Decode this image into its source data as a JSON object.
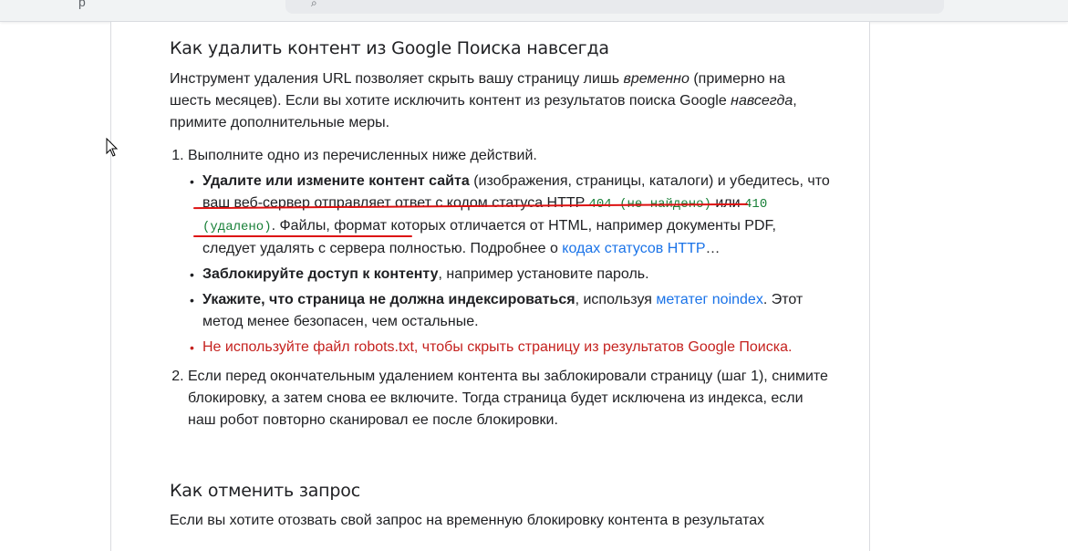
{
  "topbar": {
    "left_text": "р"
  },
  "sections": {
    "remove": {
      "title": "Как удалить контент из Google Поиска навсегда",
      "intro_1": "Инструмент удаления URL позволяет скрыть вашу страницу лишь ",
      "intro_em1": "временно",
      "intro_2": " (примерно на шесть месяцев). Если вы хотите исключить контент из результатов поиска Google ",
      "intro_em2": "навсегда",
      "intro_3": ", примите дополнительные меры.",
      "step1": "Выполните одно из перечисленных ниже действий.",
      "bullet1_bold": "Удалите или измените контент сайта",
      "bullet1_text1": " (изображения, страницы, каталоги) и убедитесь, что ваш веб-сервер отправляет ответ с кодом статуса HTTP ",
      "code404": "404 (не найдено)",
      "bullet1_or": " или ",
      "code410": "410 (удалено)",
      "bullet1_text2": ". Файлы, формат которых отличается от HTML, например документы PDF, следует удалять с сервера полностью. Подробнее о ",
      "bullet1_link": "кодах статусов HTTP",
      "bullet1_end": "…",
      "bullet2_bold": "Заблокируйте доступ к контенту",
      "bullet2_text": ", например установите пароль.",
      "bullet3_bold": "Укажите, что страница не должна индексироваться",
      "bullet3_text1": ", используя ",
      "bullet3_link": "метатег noindex",
      "bullet3_text2": ". Этот метод менее безопасен, чем остальные.",
      "bullet4_warn": "Не используйте файл robots.txt, чтобы скрыть страницу из результатов Google Поиска.",
      "step2": "Если перед окончательным удалением контента вы заблокировали страницу (шаг 1), снимите блокировку, а затем снова ее включите. Тогда страница будет исключена из индекса, если наш робот повторно сканировал ее после блокировки."
    },
    "cancel": {
      "title": "Как отменить запрос",
      "text": "Если вы хотите отозвать свой запрос на временную блокировку контента в результатах"
    }
  },
  "colors": {
    "link": "#1a73e8",
    "code": "#188038",
    "warning": "#c5221f",
    "annotation": "#dd1111"
  }
}
